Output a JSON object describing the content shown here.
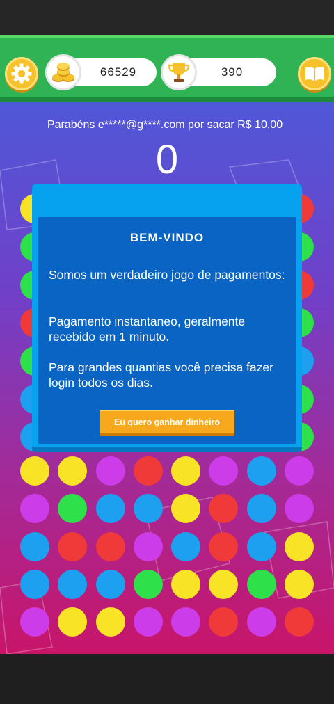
{
  "header": {
    "coins": "66529",
    "trophies": "390"
  },
  "game": {
    "congrats_text": "Parabéns e*****@g****.com por sacar R$ 10,00",
    "score": "0",
    "board_left_column": [
      "yellow",
      "green",
      "green",
      "red",
      "green",
      "blue",
      "blue"
    ],
    "board_right_column": [
      "red",
      "green",
      "red",
      "green",
      "blue",
      "green",
      "green"
    ],
    "board_rows": [
      [
        "yellow",
        "yellow",
        "purple",
        "red",
        "yellow",
        "purple",
        "blue",
        "purple"
      ],
      [
        "purple",
        "green",
        "blue",
        "blue",
        "yellow",
        "red",
        "blue",
        "purple"
      ],
      [
        "blue",
        "red",
        "red",
        "purple",
        "blue",
        "red",
        "blue",
        "yellow"
      ],
      [
        "blue",
        "blue",
        "blue",
        "green",
        "yellow",
        "yellow",
        "green",
        "yellow"
      ],
      [
        "purple",
        "yellow",
        "yellow",
        "purple",
        "purple",
        "red",
        "purple",
        "red"
      ]
    ]
  },
  "colors": {
    "yellow": "#f8e327",
    "green": "#2ee04a",
    "blue": "#1ea0f0",
    "red": "#f03a3a",
    "purple": "#cc3ce8"
  },
  "modal": {
    "title": "BEM-VINDO",
    "paragraph1": "Somos um verdadeiro jogo de pagamentos:",
    "paragraph2": "Pagamento instantaneo, geralmente recebido em 1 minuto.",
    "paragraph3": "Para grandes quantias você precisa fazer login todos os dias.",
    "button_label": "Eu quero ganhar dinheiro"
  }
}
